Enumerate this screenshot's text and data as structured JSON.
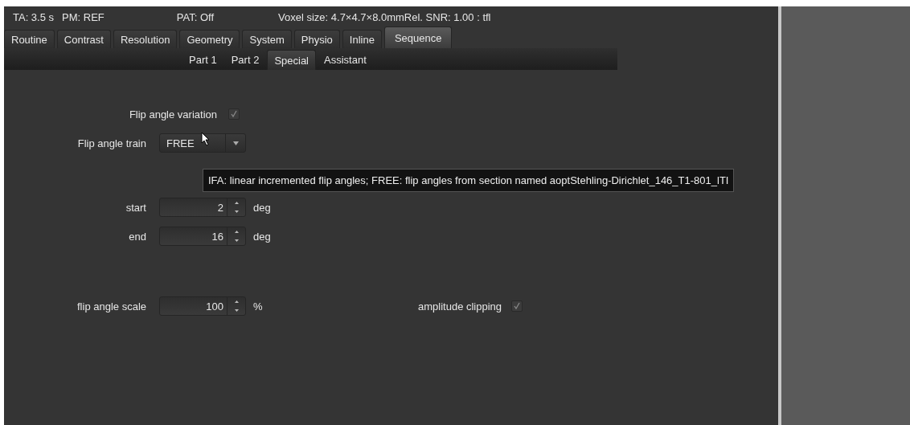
{
  "status_bar": {
    "ta": "TA: 3.5 s",
    "pm": "PM: REF",
    "pat": "PAT: Off",
    "voxel": "Voxel size: 4.7×4.7×8.0mmRel. SNR: 1.00 : tfl"
  },
  "tabs": [
    {
      "label": "Routine",
      "selected": false
    },
    {
      "label": "Contrast",
      "selected": false
    },
    {
      "label": "Resolution",
      "selected": false
    },
    {
      "label": "Geometry",
      "selected": false
    },
    {
      "label": "System",
      "selected": false
    },
    {
      "label": "Physio",
      "selected": false
    },
    {
      "label": "Inline",
      "selected": false
    },
    {
      "label": "Sequence",
      "selected": true
    }
  ],
  "subtabs": [
    {
      "label": "Part 1",
      "selected": false
    },
    {
      "label": "Part 2",
      "selected": false
    },
    {
      "label": "Special",
      "selected": true
    },
    {
      "label": "Assistant",
      "selected": false
    }
  ],
  "fields": [
    {
      "kind": "checkbox",
      "label": "Flip angle variation",
      "checked": true
    },
    {
      "kind": "dropdown",
      "label": "Flip angle train",
      "value": "FREE"
    },
    {
      "kind": "spinbox",
      "label": "start",
      "value": "2",
      "unit": "deg"
    },
    {
      "kind": "spinbox",
      "label": "end",
      "value": "16",
      "unit": "deg"
    },
    {
      "kind": "spinbox",
      "label": "flip angle scale",
      "value": "100",
      "unit": "%"
    }
  ],
  "side_fields": [
    {
      "kind": "checkbox",
      "label": "amplitude clipping",
      "checked": true
    }
  ],
  "tooltip": "IFA: linear incremented flip angles; FREE: flip angles from section named aoptStehling-Dirichlet_146_T1-801_lTI"
}
